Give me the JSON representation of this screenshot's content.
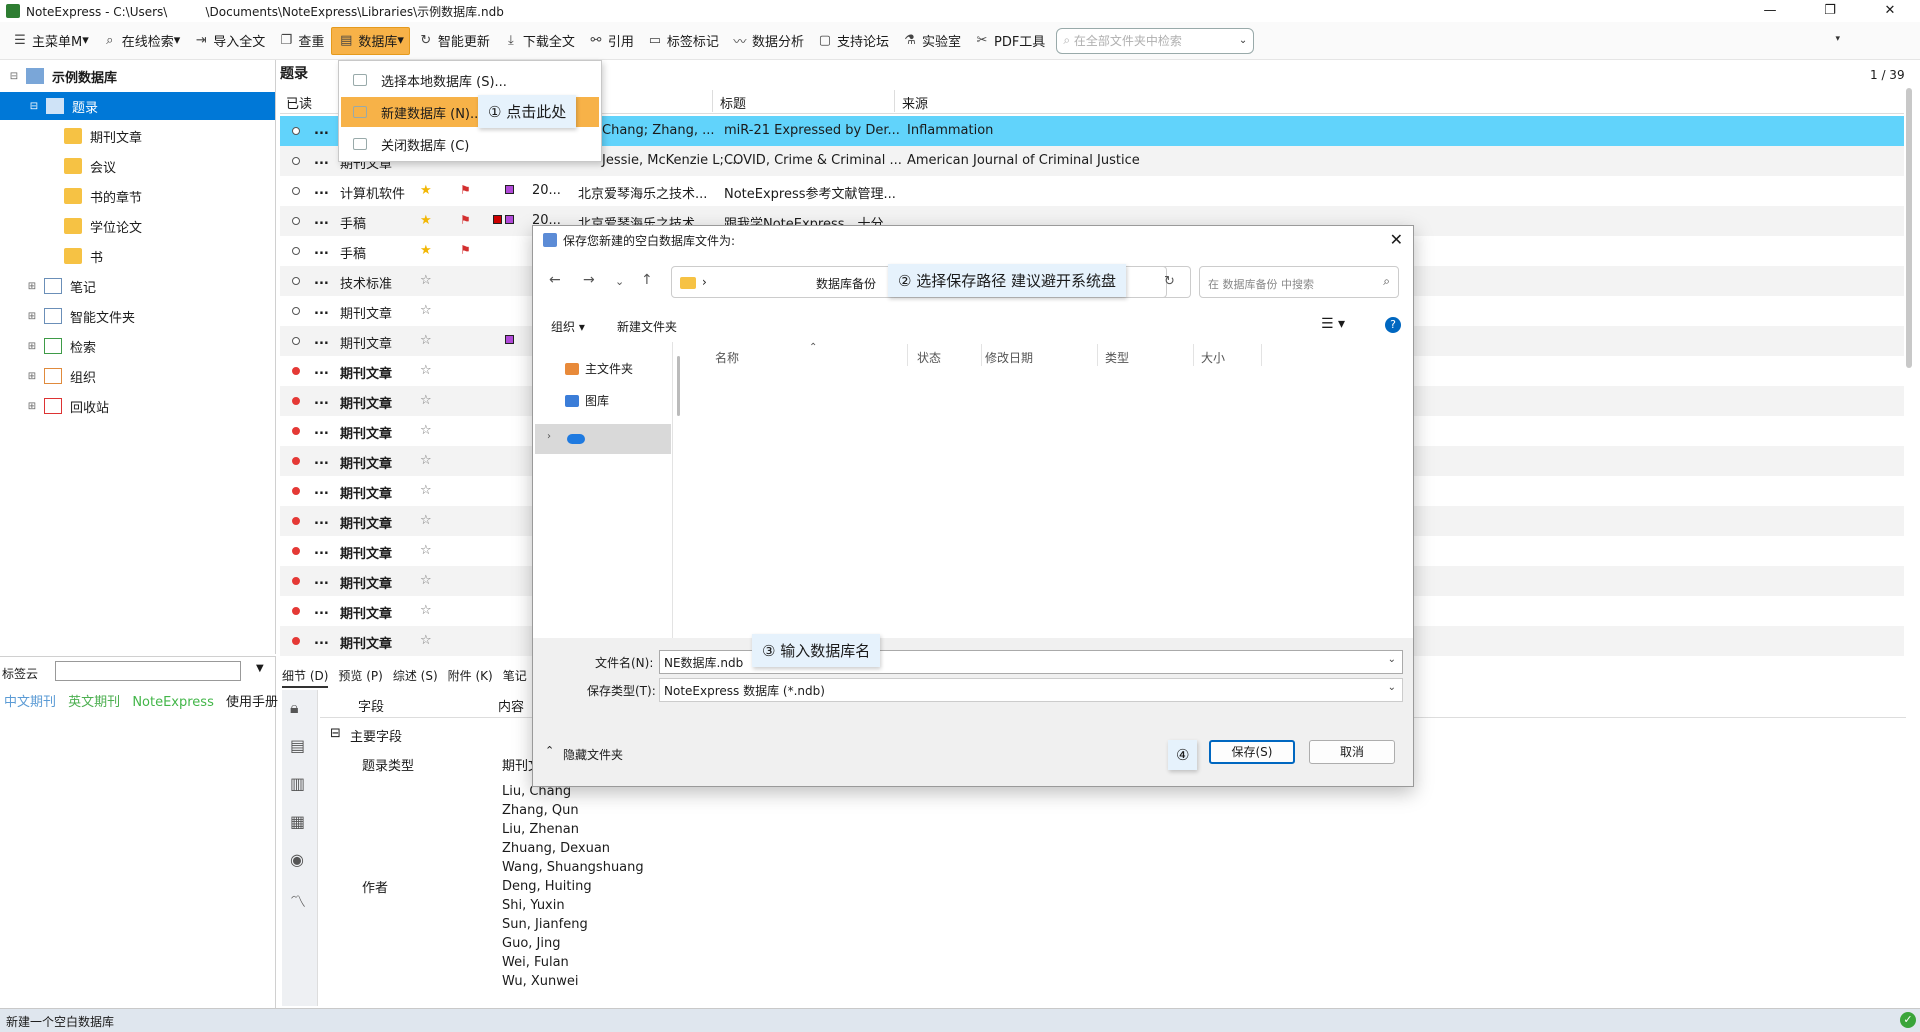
{
  "window": {
    "title": "NoteExpress - C:\\Users\\          \\Documents\\NoteExpress\\Libraries\\示例数据库.ndb",
    "controls": [
      "—",
      "❐",
      "✕"
    ]
  },
  "toolbar": {
    "items": [
      "主菜单M",
      "在线检索",
      "导入全文",
      "查重",
      "数据库",
      "智能更新",
      "下载全文",
      "引用",
      "标签标记",
      "数据分析",
      "支持论坛",
      "实验室",
      "PDF工具"
    ],
    "search_placeholder": "在全部文件夹中检索"
  },
  "tree": {
    "root": "示例数据库",
    "items": [
      "题录",
      "期刊文章",
      "会议",
      "书的章节",
      "学位论文",
      "书",
      "笔记",
      "智能文件夹",
      "检索",
      "组织",
      "回收站"
    ]
  },
  "tags": {
    "label": "标签云",
    "items": [
      {
        "text": "中文期刊",
        "color": "#5b9bd5"
      },
      {
        "text": "英文期刊",
        "color": "#4caf50"
      },
      {
        "text": "NoteExpress",
        "color": "#43b649"
      },
      {
        "text": "使用手册",
        "color": "#1b1b1b"
      }
    ]
  },
  "list": {
    "title": "题录",
    "page": "1 / 39",
    "columns": [
      "已读",
      "标题",
      "来源"
    ],
    "rows": [
      {
        "type": "...",
        "author": "Chang; Zhang, ...",
        "title": "miR-21 Expressed by Der...",
        "source": "Inflammation",
        "read": true
      },
      {
        "type": "期刊文章",
        "author": "Jessie, McKenzie L; ...",
        "title": "COVID, Crime & Criminal ...",
        "source": "American Journal of Criminal Justice",
        "read": true
      },
      {
        "type": "计算机软件",
        "year": "20...",
        "author": "北京爱琴海乐之技术...",
        "title": "NoteExpress参考文献管理...",
        "source": "",
        "read": true
      },
      {
        "type": "手稿",
        "year": "20...",
        "author": "北京爱琴海乐之技术...",
        "title": "跟我学NoteExpress，十分...",
        "source": "",
        "read": true
      },
      {
        "type": "手稿",
        "read": true
      },
      {
        "type": "技术标准",
        "read": true
      },
      {
        "type": "期刊文章",
        "read": true
      },
      {
        "type": "期刊文章",
        "read": true
      },
      {
        "type": "期刊文章",
        "read": false
      },
      {
        "type": "期刊文章",
        "read": false
      },
      {
        "type": "期刊文章",
        "read": false
      },
      {
        "type": "期刊文章",
        "read": false
      },
      {
        "type": "期刊文章",
        "read": false
      },
      {
        "type": "期刊文章",
        "read": false
      },
      {
        "type": "期刊文章",
        "read": false
      },
      {
        "type": "期刊文章",
        "read": false
      },
      {
        "type": "期刊文章",
        "read": false
      },
      {
        "type": "期刊文章",
        "read": false
      }
    ]
  },
  "detail": {
    "tabs": [
      "细节 (D)",
      "预览 (P)",
      "综述 (S)",
      "附件 (K)",
      "笔记"
    ],
    "headers": [
      "字段",
      "内容"
    ],
    "group": "主要字段",
    "ref_type_label": "题录类型",
    "ref_type_value": "期刊文",
    "author_label": "作者",
    "authors": [
      "Liu, Chang",
      "Zhang, Qun",
      "Liu, Zhenan",
      "Zhuang, Dexuan",
      "Wang, Shuangshuang",
      "Deng, Huiting",
      "Shi, Yuxin",
      "Sun, Jianfeng",
      "Guo, Jing",
      "Wei, Fulan",
      "Wu, Xunwei"
    ]
  },
  "status": {
    "text": "新建一个空白数据库",
    "ok": "✓"
  },
  "db_menu": {
    "items": [
      "选择本地数据库 (S)...",
      "新建数据库 (N)...",
      "关闭数据库 (C)"
    ]
  },
  "callouts": {
    "step1": "① 点击此处",
    "step2": "② 选择保存路径 建议避开系统盘",
    "step3": "③ 输入数据库名",
    "step4": "④"
  },
  "dialog": {
    "title": "保存您新建的空白数据库文件为:",
    "path_arrow": "›",
    "path": "数据库备份",
    "search_placeholder": "在 数据库备份 中搜索",
    "organize": "组织 ▾",
    "new_folder": "新建文件夹",
    "nav_items": [
      "主文件夹",
      "图库"
    ],
    "columns": [
      "名称",
      "状态",
      "修改日期",
      "类型",
      "大小"
    ],
    "filename_label": "文件名(N):",
    "filename_value": "NE数据库.ndb",
    "filetype_label": "保存类型(T):",
    "filetype_value": "NoteExpress 数据库 (*.ndb)",
    "hide_folders": "隐藏文件夹",
    "save": "保存(S)",
    "cancel": "取消"
  }
}
